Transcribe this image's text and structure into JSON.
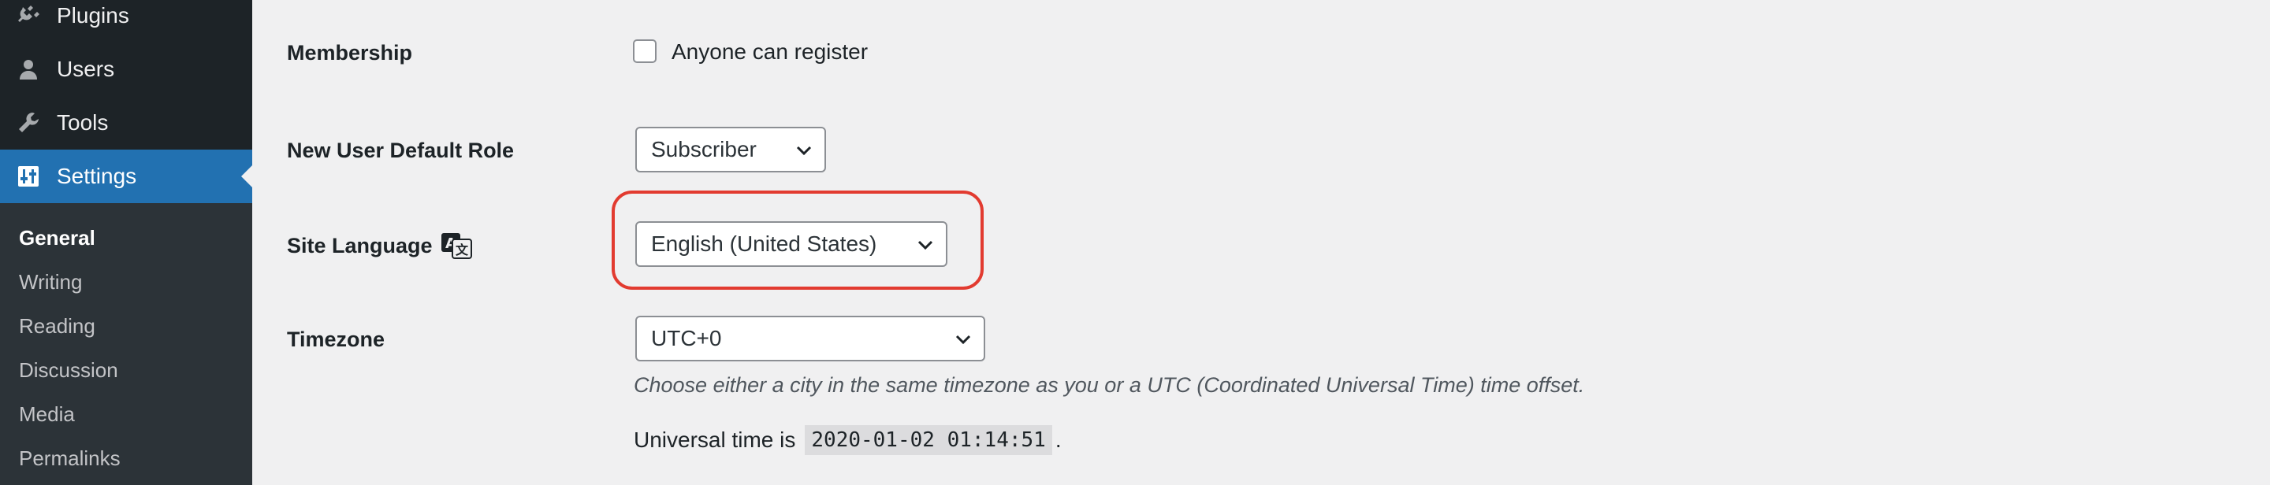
{
  "sidebar": {
    "menu": [
      {
        "label": "Plugins",
        "icon": "plug-icon"
      },
      {
        "label": "Users",
        "icon": "user-icon"
      },
      {
        "label": "Tools",
        "icon": "wrench-icon"
      },
      {
        "label": "Settings",
        "icon": "settings-sliders-icon",
        "current": true
      }
    ],
    "submenu": [
      {
        "label": "General",
        "current": true
      },
      {
        "label": "Writing"
      },
      {
        "label": "Reading"
      },
      {
        "label": "Discussion"
      },
      {
        "label": "Media"
      },
      {
        "label": "Permalinks"
      }
    ]
  },
  "settings": {
    "membership": {
      "label": "Membership",
      "checkbox_label": "Anyone can register",
      "checked": false
    },
    "default_role": {
      "label": "New User Default Role",
      "value": "Subscriber"
    },
    "site_language": {
      "label": "Site Language",
      "value": "English (United States)"
    },
    "timezone": {
      "label": "Timezone",
      "value": "UTC+0",
      "description": "Choose either a city in the same timezone as you or a UTC (Coordinated Universal Time) time offset.",
      "universal_time_prefix": "Universal time is",
      "universal_time_value": "2020-01-02 01:14:51",
      "universal_time_suffix": "."
    }
  },
  "colors": {
    "sidebar_bg": "#1d2327",
    "submenu_bg": "#2c3338",
    "accent": "#2271b1",
    "highlight": "#e23b30",
    "page_bg": "#f0f0f1"
  }
}
